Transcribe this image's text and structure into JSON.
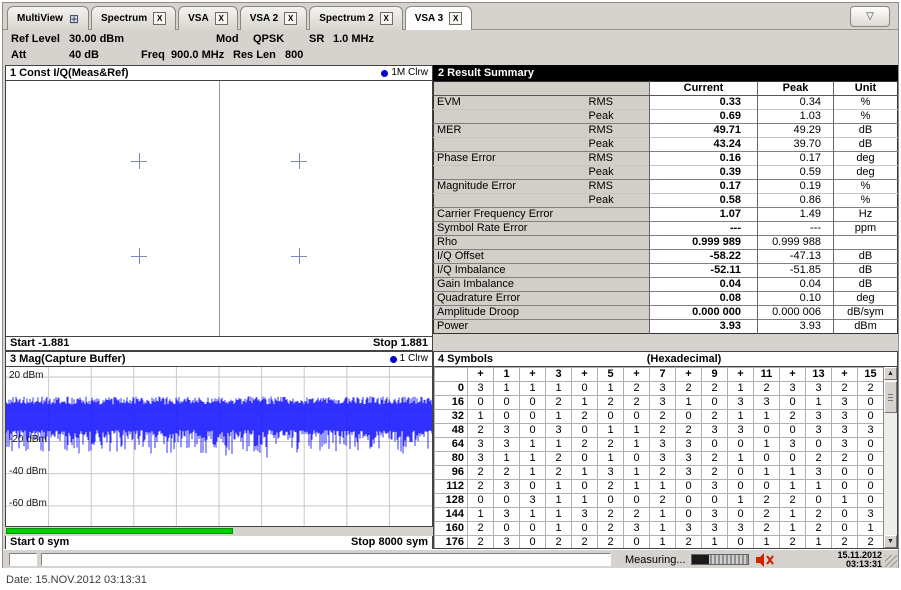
{
  "ui": {
    "close_glyph": "X",
    "overflow_glyph": "▽"
  },
  "colors": {
    "trace_blue": "#1a1aff",
    "capture_green": "#00cf00",
    "trace_dot_blue": "#0000cc",
    "const_point": "#7d88b8",
    "alert_red": "#d22000",
    "selected_header_bg": "#000000"
  },
  "tabs": [
    {
      "label": "MultiView",
      "icon": "grid",
      "closable": false,
      "active": false
    },
    {
      "label": "Spectrum",
      "closable": true,
      "active": false
    },
    {
      "label": "VSA",
      "closable": true,
      "active": false
    },
    {
      "label": "VSA 2",
      "closable": true,
      "active": false
    },
    {
      "label": "Spectrum 2",
      "closable": true,
      "active": false
    },
    {
      "label": "VSA 3",
      "closable": true,
      "active": true
    }
  ],
  "settings": {
    "ref_level": {
      "label": "Ref Level",
      "value": "30.00 dBm"
    },
    "att": {
      "label": "Att",
      "value": "40 dB"
    },
    "freq": {
      "label": "Freq",
      "value": "900.0 MHz"
    },
    "mod": {
      "label": "Mod",
      "value": "QPSK"
    },
    "res_len": {
      "label": "Res Len",
      "value": "800"
    },
    "sr": {
      "label": "SR",
      "value": "1.0 MHz"
    }
  },
  "const_panel": {
    "title": "1 Const I/Q(Meas&Ref)",
    "trace_label": "1M Clrw",
    "start": "Start -1.881",
    "stop": "Stop 1.881",
    "axis": {
      "min": -1.881,
      "max": 1.881
    },
    "points": [
      {
        "i": -0.7071,
        "q": 0.7071
      },
      {
        "i": 0.7071,
        "q": 0.7071
      },
      {
        "i": -0.7071,
        "q": -0.7071
      },
      {
        "i": 0.7071,
        "q": -0.7071
      }
    ]
  },
  "result_summary": {
    "title": "2 Result Summary",
    "columns": [
      "Current",
      "Peak",
      "Unit"
    ],
    "rows": [
      {
        "name": "EVM",
        "sub": "RMS",
        "current": "0.33",
        "peak": "0.34",
        "unit": "%",
        "group": true
      },
      {
        "name": "",
        "sub": "Peak",
        "current": "0.69",
        "peak": "1.03",
        "unit": "%",
        "group": false
      },
      {
        "name": "MER",
        "sub": "RMS",
        "current": "49.71",
        "peak": "49.29",
        "unit": "dB",
        "group": true
      },
      {
        "name": "",
        "sub": "Peak",
        "current": "43.24",
        "peak": "39.70",
        "unit": "dB",
        "group": false
      },
      {
        "name": "Phase Error",
        "sub": "RMS",
        "current": "0.16",
        "peak": "0.17",
        "unit": "deg",
        "group": true
      },
      {
        "name": "",
        "sub": "Peak",
        "current": "0.39",
        "peak": "0.59",
        "unit": "deg",
        "group": false
      },
      {
        "name": "Magnitude Error",
        "sub": "RMS",
        "current": "0.17",
        "peak": "0.19",
        "unit": "%",
        "group": true
      },
      {
        "name": "",
        "sub": "Peak",
        "current": "0.58",
        "peak": "0.86",
        "unit": "%",
        "group": false
      },
      {
        "name": "Carrier Frequency Error",
        "sub": "",
        "current": "1.07",
        "peak": "1.49",
        "unit": "Hz",
        "group": true
      },
      {
        "name": "Symbol Rate Error",
        "sub": "",
        "current": "---",
        "peak": "---",
        "unit": "ppm",
        "group": true
      },
      {
        "name": "Rho",
        "sub": "",
        "current": "0.999 989",
        "peak": "0.999 988",
        "unit": "",
        "group": true
      },
      {
        "name": "I/Q Offset",
        "sub": "",
        "current": "-58.22",
        "peak": "-47.13",
        "unit": "dB",
        "group": true
      },
      {
        "name": "I/Q Imbalance",
        "sub": "",
        "current": "-52.11",
        "peak": "-51.85",
        "unit": "dB",
        "group": true
      },
      {
        "name": "Gain Imbalance",
        "sub": "",
        "current": "0.04",
        "peak": "0.04",
        "unit": "dB",
        "group": true
      },
      {
        "name": "Quadrature Error",
        "sub": "",
        "current": "0.08",
        "peak": "0.10",
        "unit": "deg",
        "group": true
      },
      {
        "name": "Amplitude Droop",
        "sub": "",
        "current": "0.000 000",
        "peak": "0.000 006",
        "unit": "dB/sym",
        "group": true
      },
      {
        "name": "Power",
        "sub": "",
        "current": "3.93",
        "peak": "3.93",
        "unit": "dBm",
        "group": true
      }
    ]
  },
  "mag_panel": {
    "title": "3 Mag(Capture Buffer)",
    "trace_label": "1 Clrw",
    "start": "Start 0 sym",
    "stop": "Stop 8000 sym",
    "y_ticks": [
      "20 dBm",
      "-20 dBm",
      "-40 dBm",
      "-60 dBm"
    ],
    "capture_fill_percent": 53,
    "chart": {
      "type": "line",
      "x_range_sym": [
        0,
        8000
      ],
      "y_grid_dbm": [
        20,
        0,
        -20,
        -40,
        -60
      ],
      "band_top_dbm": 8,
      "band_top_span": 5,
      "band_bottom_dbm": -13,
      "band_bottom_span": 18
    }
  },
  "symbols_panel": {
    "title": "4 Symbols",
    "format_label": "(Hexadecimal)",
    "col_headers": [
      "",
      "+",
      "1",
      "+",
      "3",
      "+",
      "5",
      "+",
      "7",
      "+",
      "9",
      "+",
      "11",
      "+",
      "13",
      "+",
      "15"
    ],
    "rows": [
      {
        "index": "0",
        "values": [
          3,
          1,
          1,
          1,
          0,
          1,
          2,
          3,
          2,
          2,
          1,
          2,
          3,
          3,
          2,
          2
        ]
      },
      {
        "index": "16",
        "values": [
          0,
          0,
          0,
          2,
          1,
          2,
          2,
          3,
          1,
          0,
          3,
          3,
          0,
          1,
          3,
          0
        ]
      },
      {
        "index": "32",
        "values": [
          1,
          0,
          0,
          1,
          2,
          0,
          0,
          2,
          0,
          2,
          1,
          1,
          2,
          3,
          3,
          0
        ]
      },
      {
        "index": "48",
        "values": [
          2,
          3,
          0,
          3,
          0,
          1,
          1,
          2,
          2,
          3,
          3,
          0,
          0,
          3,
          3,
          3
        ]
      },
      {
        "index": "64",
        "values": [
          3,
          3,
          1,
          1,
          2,
          2,
          1,
          3,
          3,
          0,
          0,
          1,
          3,
          0,
          3,
          0
        ]
      },
      {
        "index": "80",
        "values": [
          3,
          1,
          1,
          2,
          0,
          1,
          0,
          3,
          3,
          2,
          1,
          0,
          0,
          2,
          2,
          0
        ]
      },
      {
        "index": "96",
        "values": [
          2,
          2,
          1,
          2,
          1,
          3,
          1,
          2,
          3,
          2,
          0,
          1,
          1,
          3,
          0,
          0
        ]
      },
      {
        "index": "112",
        "values": [
          2,
          3,
          0,
          1,
          0,
          2,
          1,
          1,
          0,
          3,
          0,
          0,
          1,
          1,
          0,
          0
        ]
      },
      {
        "index": "128",
        "values": [
          0,
          0,
          3,
          1,
          1,
          0,
          0,
          2,
          0,
          0,
          1,
          2,
          2,
          0,
          1,
          0
        ]
      },
      {
        "index": "144",
        "values": [
          1,
          3,
          1,
          1,
          3,
          2,
          2,
          1,
          0,
          3,
          0,
          2,
          1,
          2,
          0,
          3
        ]
      },
      {
        "index": "160",
        "values": [
          2,
          0,
          0,
          1,
          0,
          2,
          3,
          1,
          3,
          3,
          3,
          2,
          1,
          2,
          0,
          1
        ]
      },
      {
        "index": "176",
        "values": [
          2,
          3,
          0,
          2,
          2,
          2,
          0,
          1,
          2,
          1,
          0,
          1,
          2,
          1,
          2,
          2
        ]
      }
    ]
  },
  "status_bar": {
    "measuring": "Measuring...",
    "progress_percent": 30,
    "date": "15.11.2012",
    "time": "03:13:31"
  },
  "footer_date": "Date: 15.NOV.2012 03:13:31"
}
